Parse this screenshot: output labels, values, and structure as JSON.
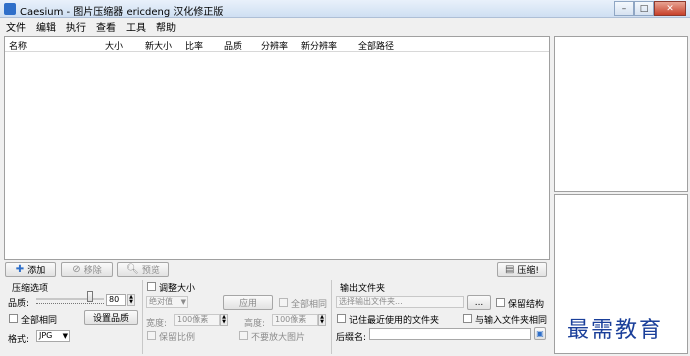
{
  "window": {
    "title": "Caesium - 图片压缩器 ericdeng 汉化修正版",
    "controls": {
      "minimize": "–",
      "maximize": "□",
      "close": "✕"
    }
  },
  "menu": [
    "文件",
    "编辑",
    "执行",
    "查看",
    "工具",
    "帮助"
  ],
  "table": {
    "columns": [
      "名称",
      "大小",
      "新大小",
      "比率",
      "品质",
      "分辨率",
      "新分辨率",
      "全部路径"
    ],
    "rows": []
  },
  "toolbar": {
    "add_label": "添加",
    "remove_label": "移除",
    "preview_label": "预览",
    "compress_label": "压缩!"
  },
  "compression": {
    "title": "压缩选项",
    "quality_label": "品质:",
    "quality_value": "80",
    "quality_level": 0.8,
    "all_same_label": "全部相同",
    "set_quality_label": "设置品质",
    "format_label": "格式:",
    "format_value": "JPG"
  },
  "resize": {
    "title": "调整大小",
    "mode_value": "绝对值",
    "apply_label": "应用",
    "all_same_label": "全部相同",
    "width_label": "宽度:",
    "width_value": "100像素",
    "height_label": "高度:",
    "height_value": "100像素",
    "keep_ratio_label": "保留比例",
    "no_enlarge_label": "不要放大图片"
  },
  "output": {
    "title": "输出文件夹",
    "folder_placeholder": "选择输出文件夹...",
    "browse_label": "...",
    "keep_structure_label": "保留结构",
    "remember_label": "记住最近使用的文件夹",
    "same_as_input_label": "与输入文件夹相同",
    "suffix_label": "后缀名:"
  },
  "watermark": "最需教育",
  "colors": {
    "accent": "#2f6fc9",
    "watermark": "#1a3f9a"
  }
}
